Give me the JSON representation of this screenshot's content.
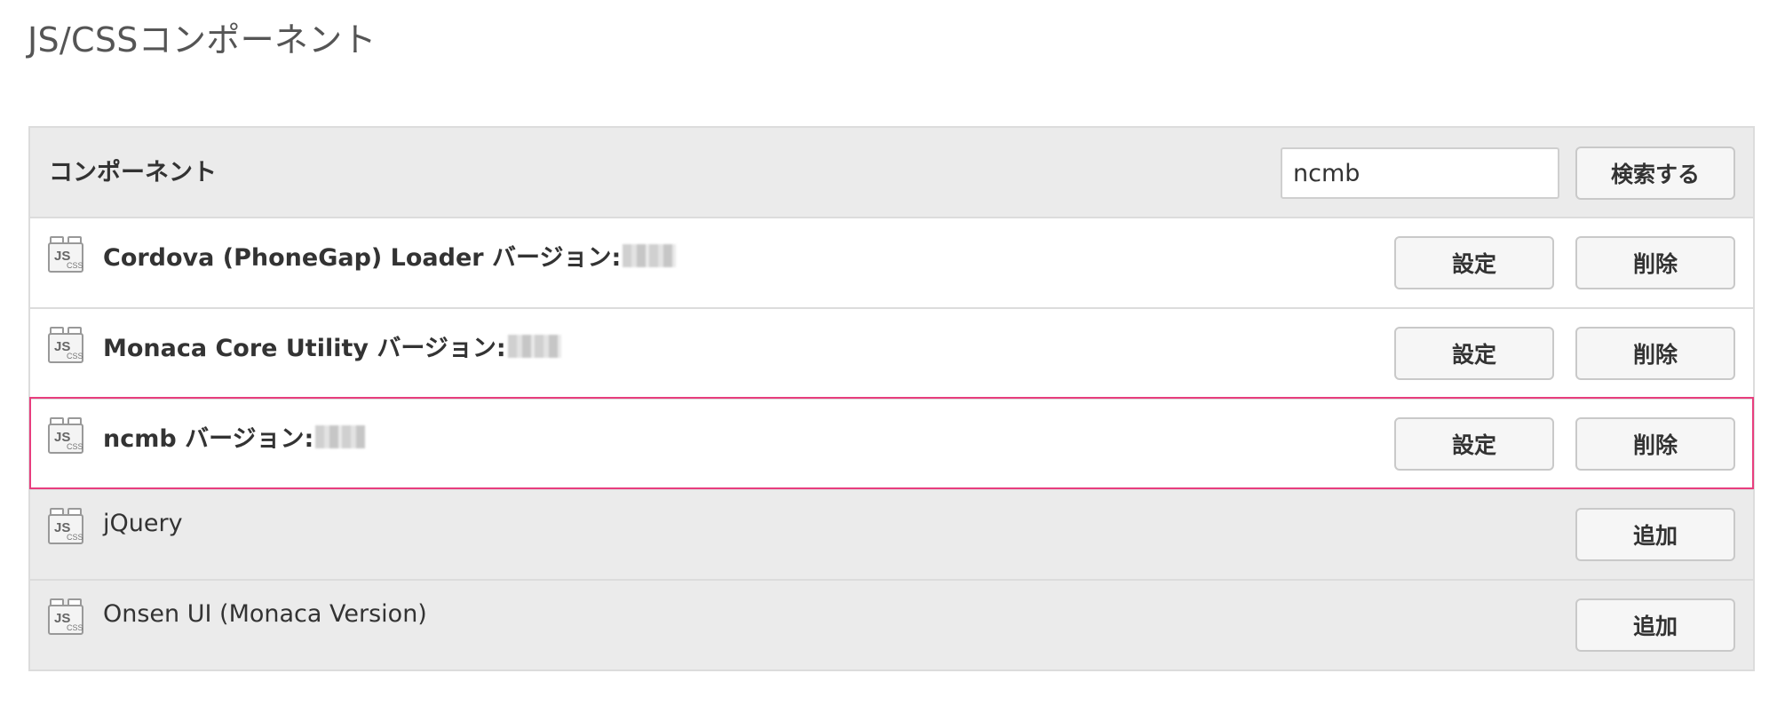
{
  "page": {
    "title": "JS/CSSコンポーネント"
  },
  "header": {
    "label": "コンポーネント",
    "search_value": "ncmb",
    "search_button": "検索する"
  },
  "components": [
    {
      "name": "Cordova (PhoneGap) Loader バージョン:",
      "installed": true,
      "settings_label": "設定",
      "delete_label": "削除",
      "highlighted": false
    },
    {
      "name": "Monaca Core Utility バージョン:",
      "installed": true,
      "settings_label": "設定",
      "delete_label": "削除",
      "highlighted": false
    },
    {
      "name": "ncmb バージョン:",
      "installed": true,
      "settings_label": "設定",
      "delete_label": "削除",
      "highlighted": true
    },
    {
      "name": "jQuery",
      "installed": false,
      "add_label": "追加"
    },
    {
      "name": "Onsen UI (Monaca Version)",
      "installed": false,
      "add_label": "追加"
    }
  ],
  "colors": {
    "highlight": "#e83e7e",
    "row_grey": "#ebebeb",
    "border": "#dcdcdc"
  },
  "icons": {
    "component": "js-css-component-icon"
  }
}
